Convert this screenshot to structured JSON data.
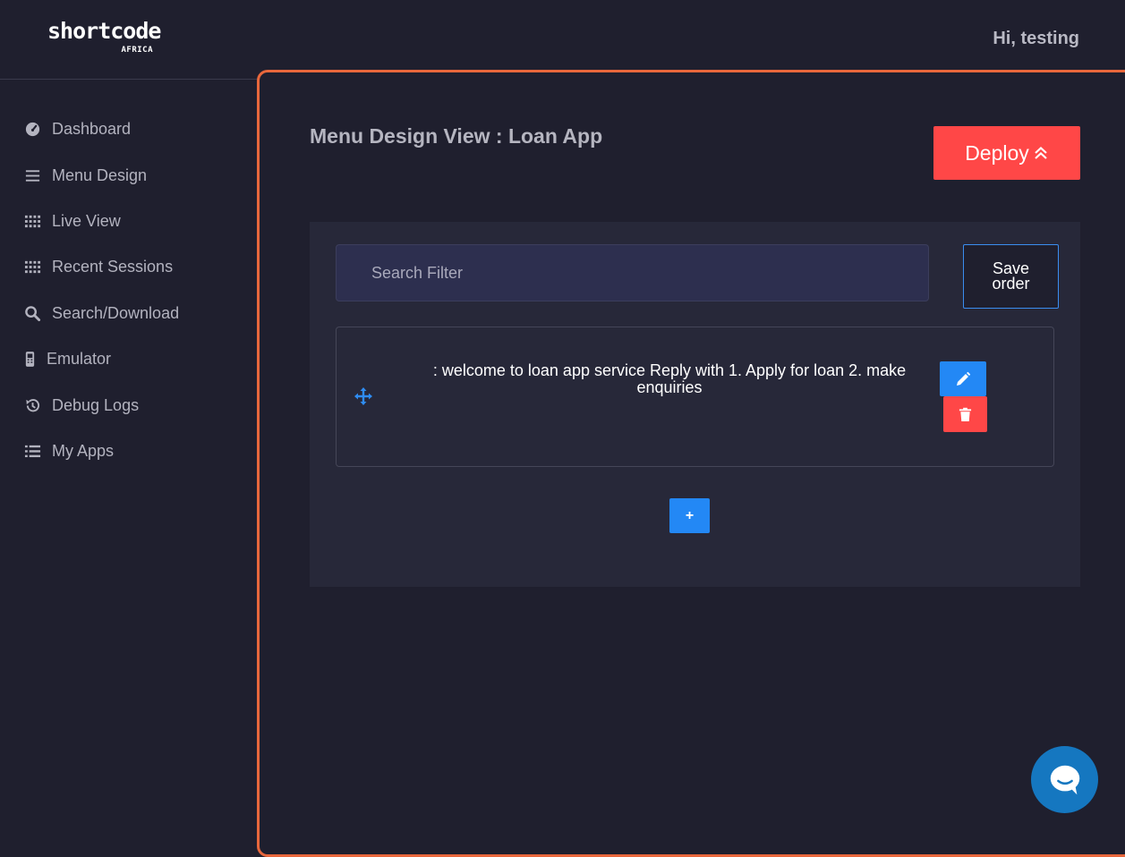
{
  "brand": {
    "logo_text": "shortcode",
    "logo_subtext": "AFRICA"
  },
  "header": {
    "greeting": "Hi, testing"
  },
  "sidebar": {
    "items": [
      {
        "label": "Dashboard",
        "icon": "dashboard-gauge-icon"
      },
      {
        "label": "Menu Design",
        "icon": "menu-bars-icon"
      },
      {
        "label": "Live View",
        "icon": "grid-dots-icon"
      },
      {
        "label": "Recent Sessions",
        "icon": "grid-dots-icon"
      },
      {
        "label": "Search/Download",
        "icon": "search-icon"
      },
      {
        "label": "Emulator",
        "icon": "mobile-phone-icon"
      },
      {
        "label": "Debug Logs",
        "icon": "history-icon"
      },
      {
        "label": "My Apps",
        "icon": "list-icon"
      }
    ]
  },
  "main": {
    "title": "Menu Design View : Loan App",
    "deploy_label": "Deploy",
    "search": {
      "placeholder": "Search Filter",
      "value": ""
    },
    "save_order_label": "Save order",
    "menu_items": [
      {
        "text": ": welcome to loan app service Reply with 1. Apply for loan 2. make enquiries"
      }
    ],
    "add_label": "+"
  },
  "colors": {
    "accent_border": "#e8673c",
    "deploy": "#ff4747",
    "primary": "#2388f5",
    "chat": "#1577c0"
  }
}
